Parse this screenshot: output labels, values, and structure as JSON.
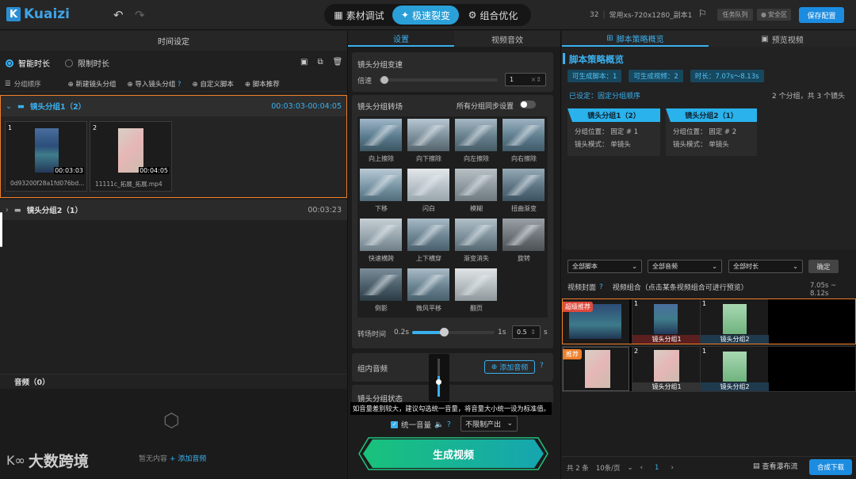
{
  "app": {
    "name": "Kuaizi",
    "logo_letter": "K"
  },
  "topbar": {
    "tabs": [
      {
        "label": "素材调试",
        "icon": "film-icon"
      },
      {
        "label": "极速裂变",
        "icon": "sparkle-icon",
        "active": true
      },
      {
        "label": "组合优化",
        "icon": "gear-icon"
      }
    ],
    "project_count": "32",
    "project_name": "常用xs-720x1280_副本1",
    "task_queue": "任务队列",
    "safe_zone": "安全区",
    "save_config": "保存配置"
  },
  "left": {
    "title": "时间设定",
    "mode_smart": "智能时长",
    "mode_limit": "限制时长",
    "order_label": "分组顺序",
    "actions": [
      "新建镜头分组",
      "导入镜头分组",
      "自定义脚本",
      "脚本推荐"
    ],
    "group1": {
      "name": "镜头分组1（2）",
      "time": "00:03:03-00:04:05",
      "clips": [
        {
          "idx": "1",
          "dur": "00:03:03",
          "name": "0d93200f28a1fd076bd..."
        },
        {
          "idx": "2",
          "dur": "00:04:05",
          "name": "11111c_拓展_拓展.mp4"
        }
      ]
    },
    "group2": {
      "name": "镜头分组2（1）",
      "time": "00:03:23"
    },
    "audio_title": "音频（0）",
    "empty_text": "暂无内容",
    "add_audio": "+ 添加音频"
  },
  "watermark": {
    "text": "大数跨境"
  },
  "middle": {
    "tab_settings": "设置",
    "tab_effects": "视频音效",
    "speed_title": "镜头分组变速",
    "speed_label": "倍速",
    "speed_value": "1",
    "transition_title": "镜头分组转场",
    "sync_label": "所有分组同步设置",
    "transitions": [
      "向上擦除",
      "向下擦除",
      "向左擦除",
      "向右擦除",
      "下移",
      "闪白",
      "模糊",
      "扭曲渐变",
      "快速横跨",
      "上下横穿",
      "渐变消失",
      "旋转",
      "倒影",
      "微风平移",
      "翻页"
    ],
    "transition_time_label": "转场时间",
    "t_min": "0.2s",
    "t_max": "1s",
    "t_value": "0.5",
    "t_unit": "s",
    "group_audio": "组内音频",
    "add_audio_btn": "添加音频",
    "group_state": "镜头分组状态",
    "tooltip": "如音量差别较大，建议勾选统一音量，将音量大小统一设为标准值。",
    "unify_volume": "统一音量",
    "output_limit": "不限制产出",
    "generate": "生成视频"
  },
  "right": {
    "tab_strategy": "脚本策略概览",
    "tab_preview": "预览视频",
    "title": "脚本策略概览",
    "badges": [
      "可生成脚本：1",
      "可生成视频：2",
      "时长：7.07s～8.13s"
    ],
    "setting": "已设定：固定分组顺序",
    "summary": "2 个分组，共 3 个镜头",
    "cards": [
      {
        "title": "镜头分组1（2）",
        "pos": "分组位置：  固定 # 1",
        "mode": "镜头模式：  单镜头"
      },
      {
        "title": "镜头分组2（1）",
        "pos": "分组位置：  固定 # 2",
        "mode": "镜头模式：  单镜头"
      }
    ],
    "filters": [
      "全部脚本",
      "全部音频",
      "全部时长"
    ],
    "confirm": "确定",
    "cover_label": "视频封面",
    "combo_label": "视频组合（点击某条视频组合可进行预览）",
    "duration_range": "7.05s ~ 8.12s",
    "rows": [
      {
        "badge": "超级推荐",
        "num": "1",
        "cells": [
          {
            "n": "1",
            "label": "镜头分组1"
          },
          {
            "n": "1",
            "label": "镜头分组2"
          }
        ]
      },
      {
        "badge": "推荐",
        "num": "2",
        "cells": [
          {
            "n": "2",
            "label": "镜头分组1"
          },
          {
            "n": "1",
            "label": "镜头分组2"
          }
        ]
      }
    ],
    "total": "共 2 条",
    "page_size": "10条/页",
    "page": "1",
    "waterfall": "查看瀑布流",
    "compose_download": "合成下载"
  },
  "colors": {
    "accent": "#2a9fd8",
    "orange": "#f07f2a",
    "green": "#1ec57e"
  }
}
